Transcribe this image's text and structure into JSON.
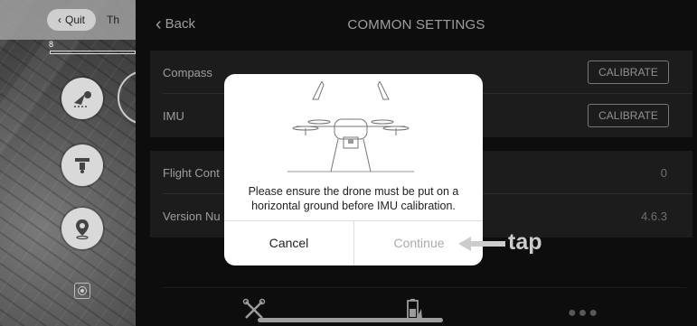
{
  "map": {
    "quit_label": "Quit",
    "title_fragment": "Th",
    "small_indicator": "8",
    "buttons": [
      "route-plan-icon",
      "drone-camera-icon",
      "location-pin-icon"
    ],
    "locate_icon": "target-icon"
  },
  "header": {
    "back_label": "Back",
    "title": "COMMON SETTINGS"
  },
  "rows": {
    "compass": {
      "label": "Compass",
      "button": "CALIBRATE"
    },
    "imu": {
      "label": "IMU",
      "button": "CALIBRATE"
    },
    "flight_control": {
      "label": "Flight Cont",
      "value": "0"
    },
    "version": {
      "label": "Version Nu",
      "value": "4.6.3"
    }
  },
  "dialog": {
    "message": "Please ensure the drone must be put on a horizontal ground before IMU calibration.",
    "cancel_label": "Cancel",
    "continue_label": "Continue"
  },
  "annotation": {
    "text": "tap"
  },
  "tabbar": {
    "icons": [
      "drone-icon",
      "battery-icon",
      "more-icon"
    ]
  }
}
